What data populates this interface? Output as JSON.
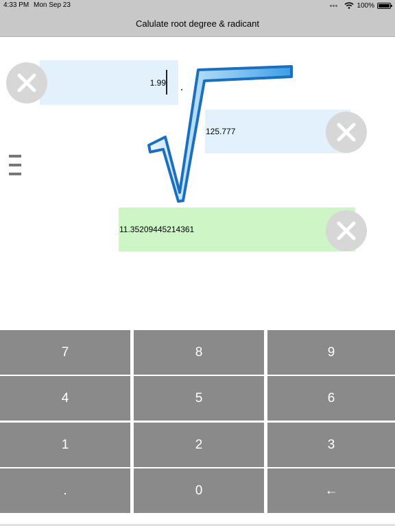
{
  "status_bar": {
    "time": "4:33 PM",
    "date": "Mon Sep 23",
    "battery": "100%",
    "battery_level": 1.0
  },
  "nav": {
    "title": "Calulate root degree & radicant"
  },
  "fields": {
    "degree": "1.99",
    "radicand": "125.777",
    "result": "11.35209445214361"
  },
  "icons": {
    "clear": "close-x-icon",
    "menu": "hamburger-menu-icon",
    "root": "square-root-symbol",
    "backspace": "left-arrow-icon",
    "wifi": "wifi-icon",
    "battery": "battery-icon"
  },
  "colors": {
    "input_bg": "#e2f1fc",
    "result_bg": "#cdf5c6",
    "key_bg": "#8a8a8a",
    "clear_bg": "#d7d7d7",
    "root_blue": "#3b9ee6",
    "bar_bg": "#c8c8c8"
  },
  "keypad": {
    "keys": [
      [
        "7",
        "8",
        "9"
      ],
      [
        "4",
        "5",
        "6"
      ],
      [
        "1",
        "2",
        "3"
      ],
      [
        ".",
        "0",
        "←"
      ]
    ]
  }
}
